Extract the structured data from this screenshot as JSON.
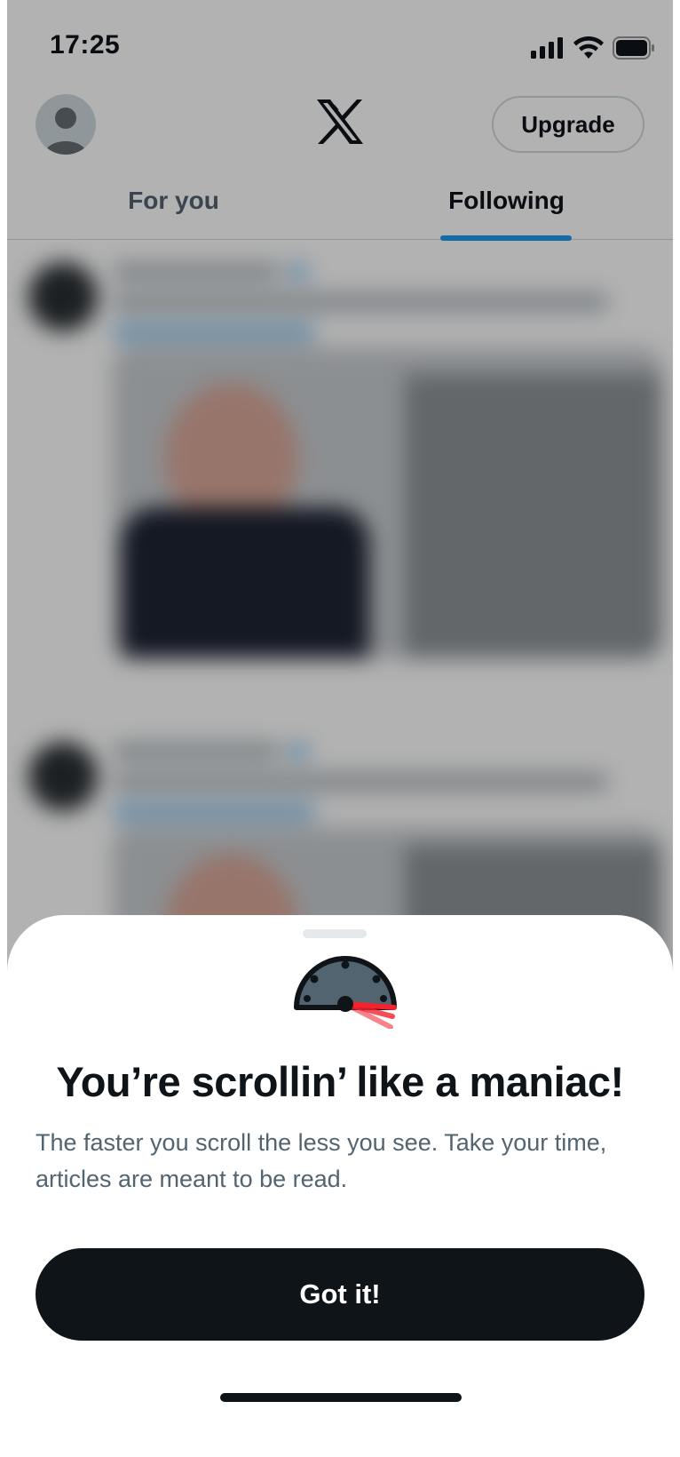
{
  "status_bar": {
    "time": "17:25",
    "icons": [
      "cellular-signal-icon",
      "wifi-icon",
      "battery-icon"
    ]
  },
  "header": {
    "logo": "x-logo-icon",
    "upgrade_label": "Upgrade",
    "tabs": [
      {
        "label": "For you",
        "active": false
      },
      {
        "label": "Following",
        "active": true
      }
    ]
  },
  "bottom_sheet": {
    "icon": "speedometer-icon",
    "title": "You’re scrollin’ like a maniac!",
    "body": "The faster you scroll the less you see. Take your time, articles are meant to be read.",
    "button_label": "Got it!"
  },
  "colors": {
    "accent": "#1d9bf0",
    "text_primary": "#0f1419",
    "text_secondary": "#536471",
    "button_bg": "#0f1419",
    "gauge_needle": "#f4212e"
  }
}
